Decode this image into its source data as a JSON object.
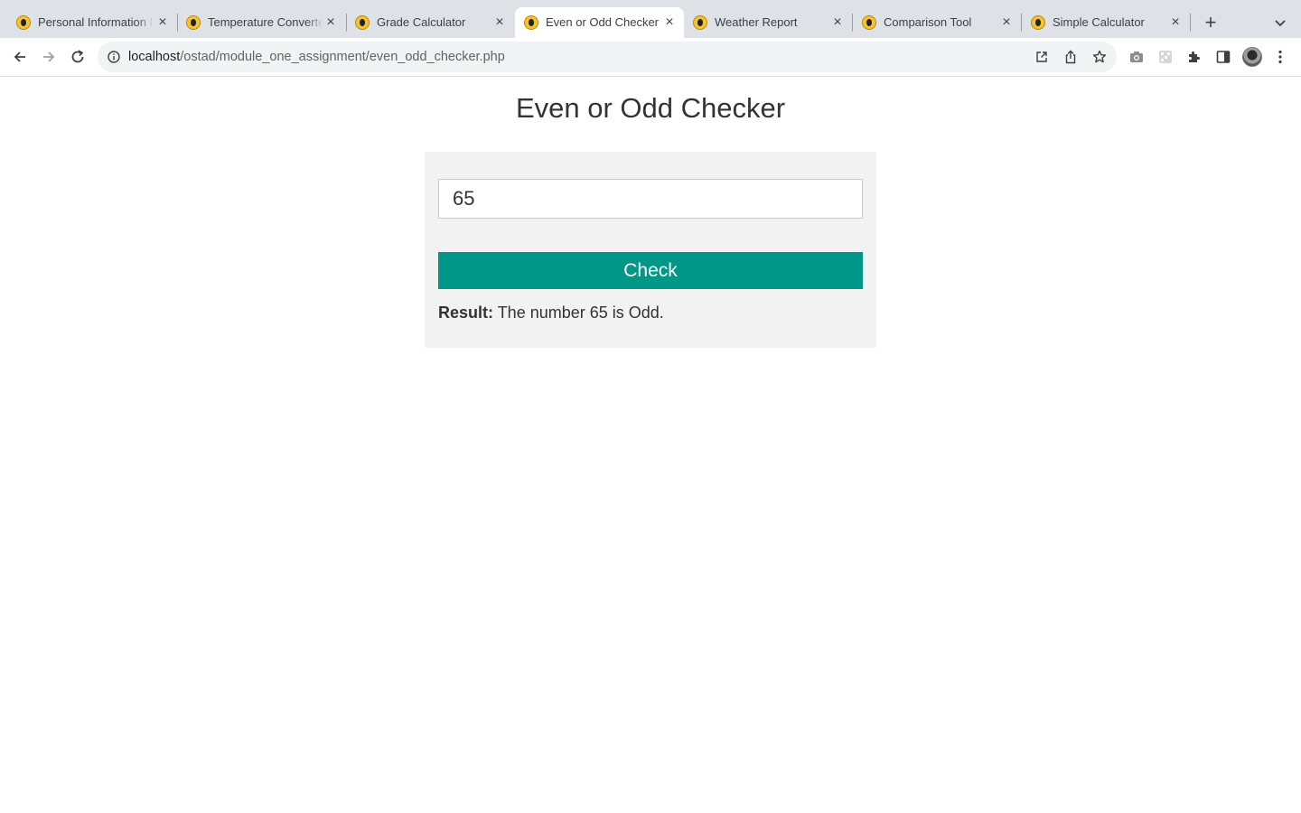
{
  "browser": {
    "tabs": [
      {
        "title": "Personal Information Form",
        "active": false
      },
      {
        "title": "Temperature Converter",
        "active": false
      },
      {
        "title": "Grade Calculator",
        "active": false
      },
      {
        "title": "Even or Odd Checker",
        "active": true
      },
      {
        "title": "Weather Report",
        "active": false
      },
      {
        "title": "Comparison Tool",
        "active": false
      },
      {
        "title": "Simple Calculator",
        "active": false
      }
    ],
    "address": {
      "host": "localhost",
      "path": "/ostad/module_one_assignment/even_odd_checker.php"
    }
  },
  "page": {
    "title": "Even or Odd Checker",
    "number_input_value": "65",
    "check_button_label": "Check",
    "result_label": "Result:",
    "result_text": " The number 65 is Odd."
  },
  "colors": {
    "button": "#009688",
    "card": "#f2f2f2",
    "tabstrip": "#dee1e6"
  }
}
